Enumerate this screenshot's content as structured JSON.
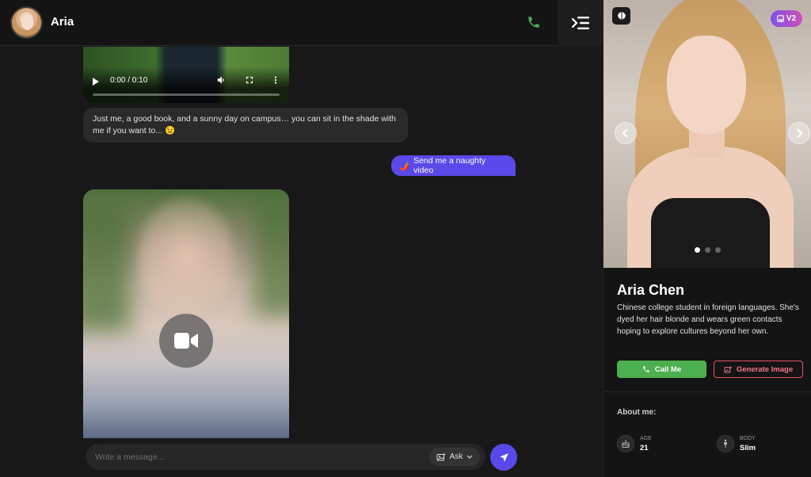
{
  "header": {
    "name": "Aria"
  },
  "video_player": {
    "time": "0:00 / 0:10",
    "progress_fraction": 0
  },
  "messages": {
    "incoming_1": "Just me, a good book, and a sunny day on campus… you can sit in the shade with me if you want to... 😉",
    "outgoing_1": "Send me a naughty video",
    "outgoing_1_emoji": "🌶️"
  },
  "composer": {
    "placeholder": "Write a message...",
    "ask_label": "Ask"
  },
  "profile": {
    "v2_badge": "V2",
    "name": "Aria Chen",
    "description": "Chinese college student in foreign languages. She's dyed her hair blonde and wears green contacts hoping to explore cultures beyond her own.",
    "call_label": "Call Me",
    "generate_label": "Generate Image",
    "about_title": "About me:",
    "stats": [
      {
        "label": "AGE",
        "value": "21",
        "icon": "age-icon"
      },
      {
        "label": "BODY",
        "value": "Slim",
        "icon": "body-icon"
      }
    ]
  },
  "colors": {
    "accent": "#5b48e8",
    "call_green": "#4caf50",
    "generate_pink": "#e2546c"
  }
}
